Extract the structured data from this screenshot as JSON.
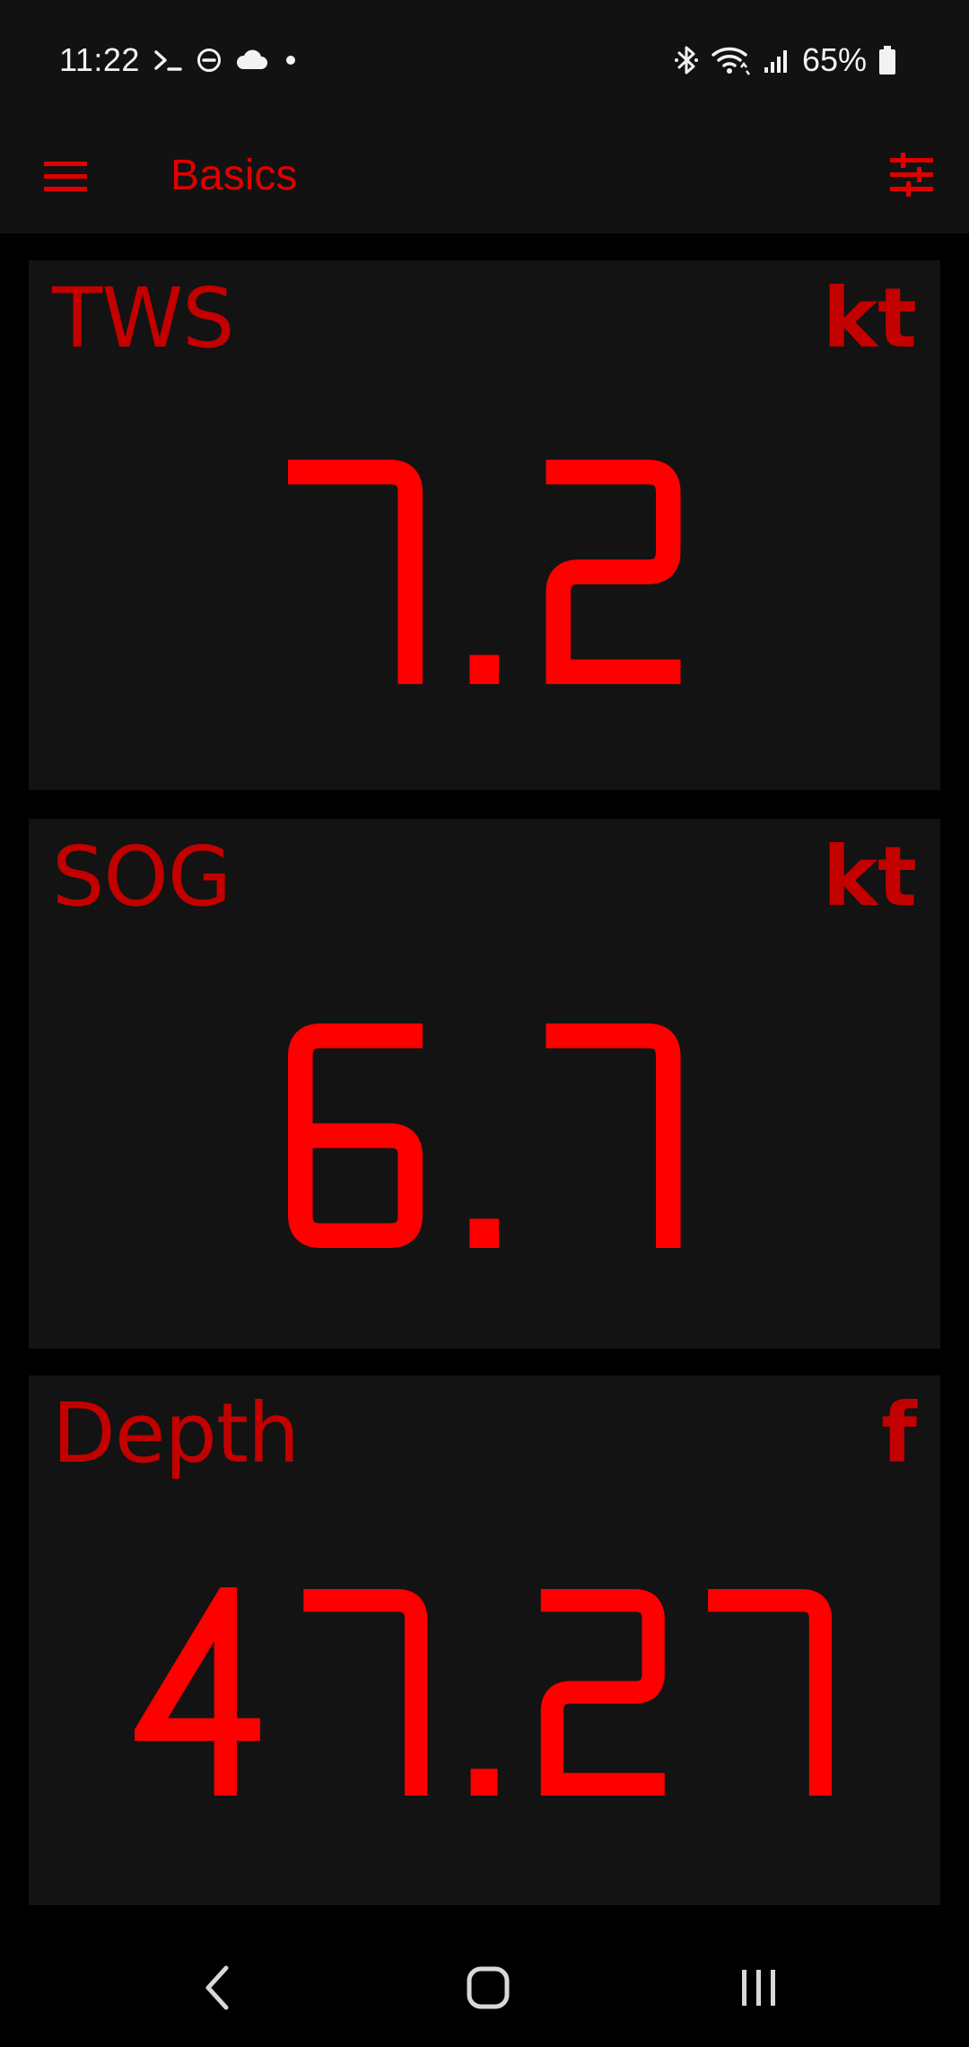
{
  "status_bar": {
    "time": "11:22",
    "battery_percent": "65%",
    "icons_left": [
      "terminal-icon",
      "do-not-disturb-icon",
      "cloud-icon",
      "dot-icon"
    ],
    "icons_right": [
      "bluetooth-icon",
      "wifi-icon",
      "signal-icon",
      "battery-icon"
    ]
  },
  "app_bar": {
    "title": "Basics",
    "menu_icon": "hamburger-menu-icon",
    "action_icon": "tune-settings-icon"
  },
  "theme": {
    "accent": "#ff0000",
    "label_color": "#c30000",
    "panel_bg": "#131313",
    "page_bg": "#000000"
  },
  "panels": [
    {
      "label": "TWS",
      "unit": "kt",
      "value": "7.2"
    },
    {
      "label": "SOG",
      "unit": "kt",
      "value": "6.7"
    },
    {
      "label": "Depth",
      "unit": "f",
      "value": "47.27"
    }
  ],
  "nav_bar": {
    "icons": [
      "back-icon",
      "home-icon",
      "recents-icon"
    ]
  }
}
